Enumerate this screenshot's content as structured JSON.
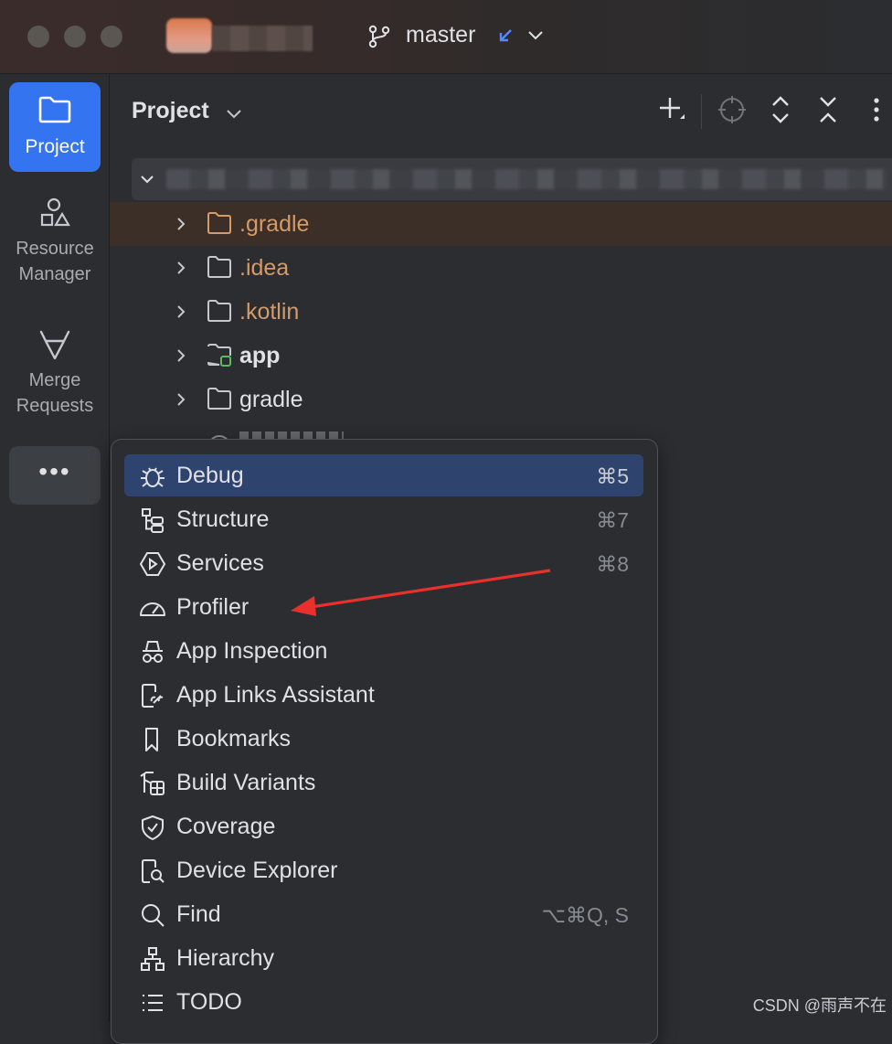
{
  "titlebar": {
    "branch": "master"
  },
  "toolstrip": {
    "items": [
      {
        "label": "Project"
      },
      {
        "label": "Resource\nManager"
      },
      {
        "label": "Merge\nRequests"
      }
    ],
    "more": "•••"
  },
  "panel": {
    "title": "Project",
    "tree": [
      {
        "name": ".gradle",
        "style": "orange"
      },
      {
        "name": ".idea",
        "style": "orange"
      },
      {
        "name": ".kotlin",
        "style": "orange"
      },
      {
        "name": "app",
        "style": "bold"
      },
      {
        "name": "gradle",
        "style": "plain"
      }
    ]
  },
  "menu": {
    "items": [
      {
        "label": "Debug",
        "shortcut": "⌘5",
        "icon": "bug-icon"
      },
      {
        "label": "Structure",
        "shortcut": "⌘7",
        "icon": "structure-icon"
      },
      {
        "label": "Services",
        "shortcut": "⌘8",
        "icon": "services-icon"
      },
      {
        "label": "Profiler",
        "shortcut": "",
        "icon": "gauge-icon"
      },
      {
        "label": "App Inspection",
        "shortcut": "",
        "icon": "spy-icon"
      },
      {
        "label": "App Links Assistant",
        "shortcut": "",
        "icon": "app-link-icon"
      },
      {
        "label": "Bookmarks",
        "shortcut": "",
        "icon": "bookmark-icon"
      },
      {
        "label": "Build Variants",
        "shortcut": "",
        "icon": "build-variants-icon"
      },
      {
        "label": "Coverage",
        "shortcut": "",
        "icon": "shield-check-icon"
      },
      {
        "label": "Device Explorer",
        "shortcut": "",
        "icon": "device-search-icon"
      },
      {
        "label": "Find",
        "shortcut": "⌥⌘Q, S",
        "icon": "search-icon"
      },
      {
        "label": "Hierarchy",
        "shortcut": "",
        "icon": "hierarchy-icon"
      },
      {
        "label": "TODO",
        "shortcut": "",
        "icon": "list-icon"
      }
    ]
  },
  "watermark": "CSDN @雨声不在",
  "colors": {
    "accent": "#3574f0",
    "menu_hover": "#2e436e",
    "folder_orange": "#d49a6a",
    "annotation_arrow": "#e8302c"
  }
}
